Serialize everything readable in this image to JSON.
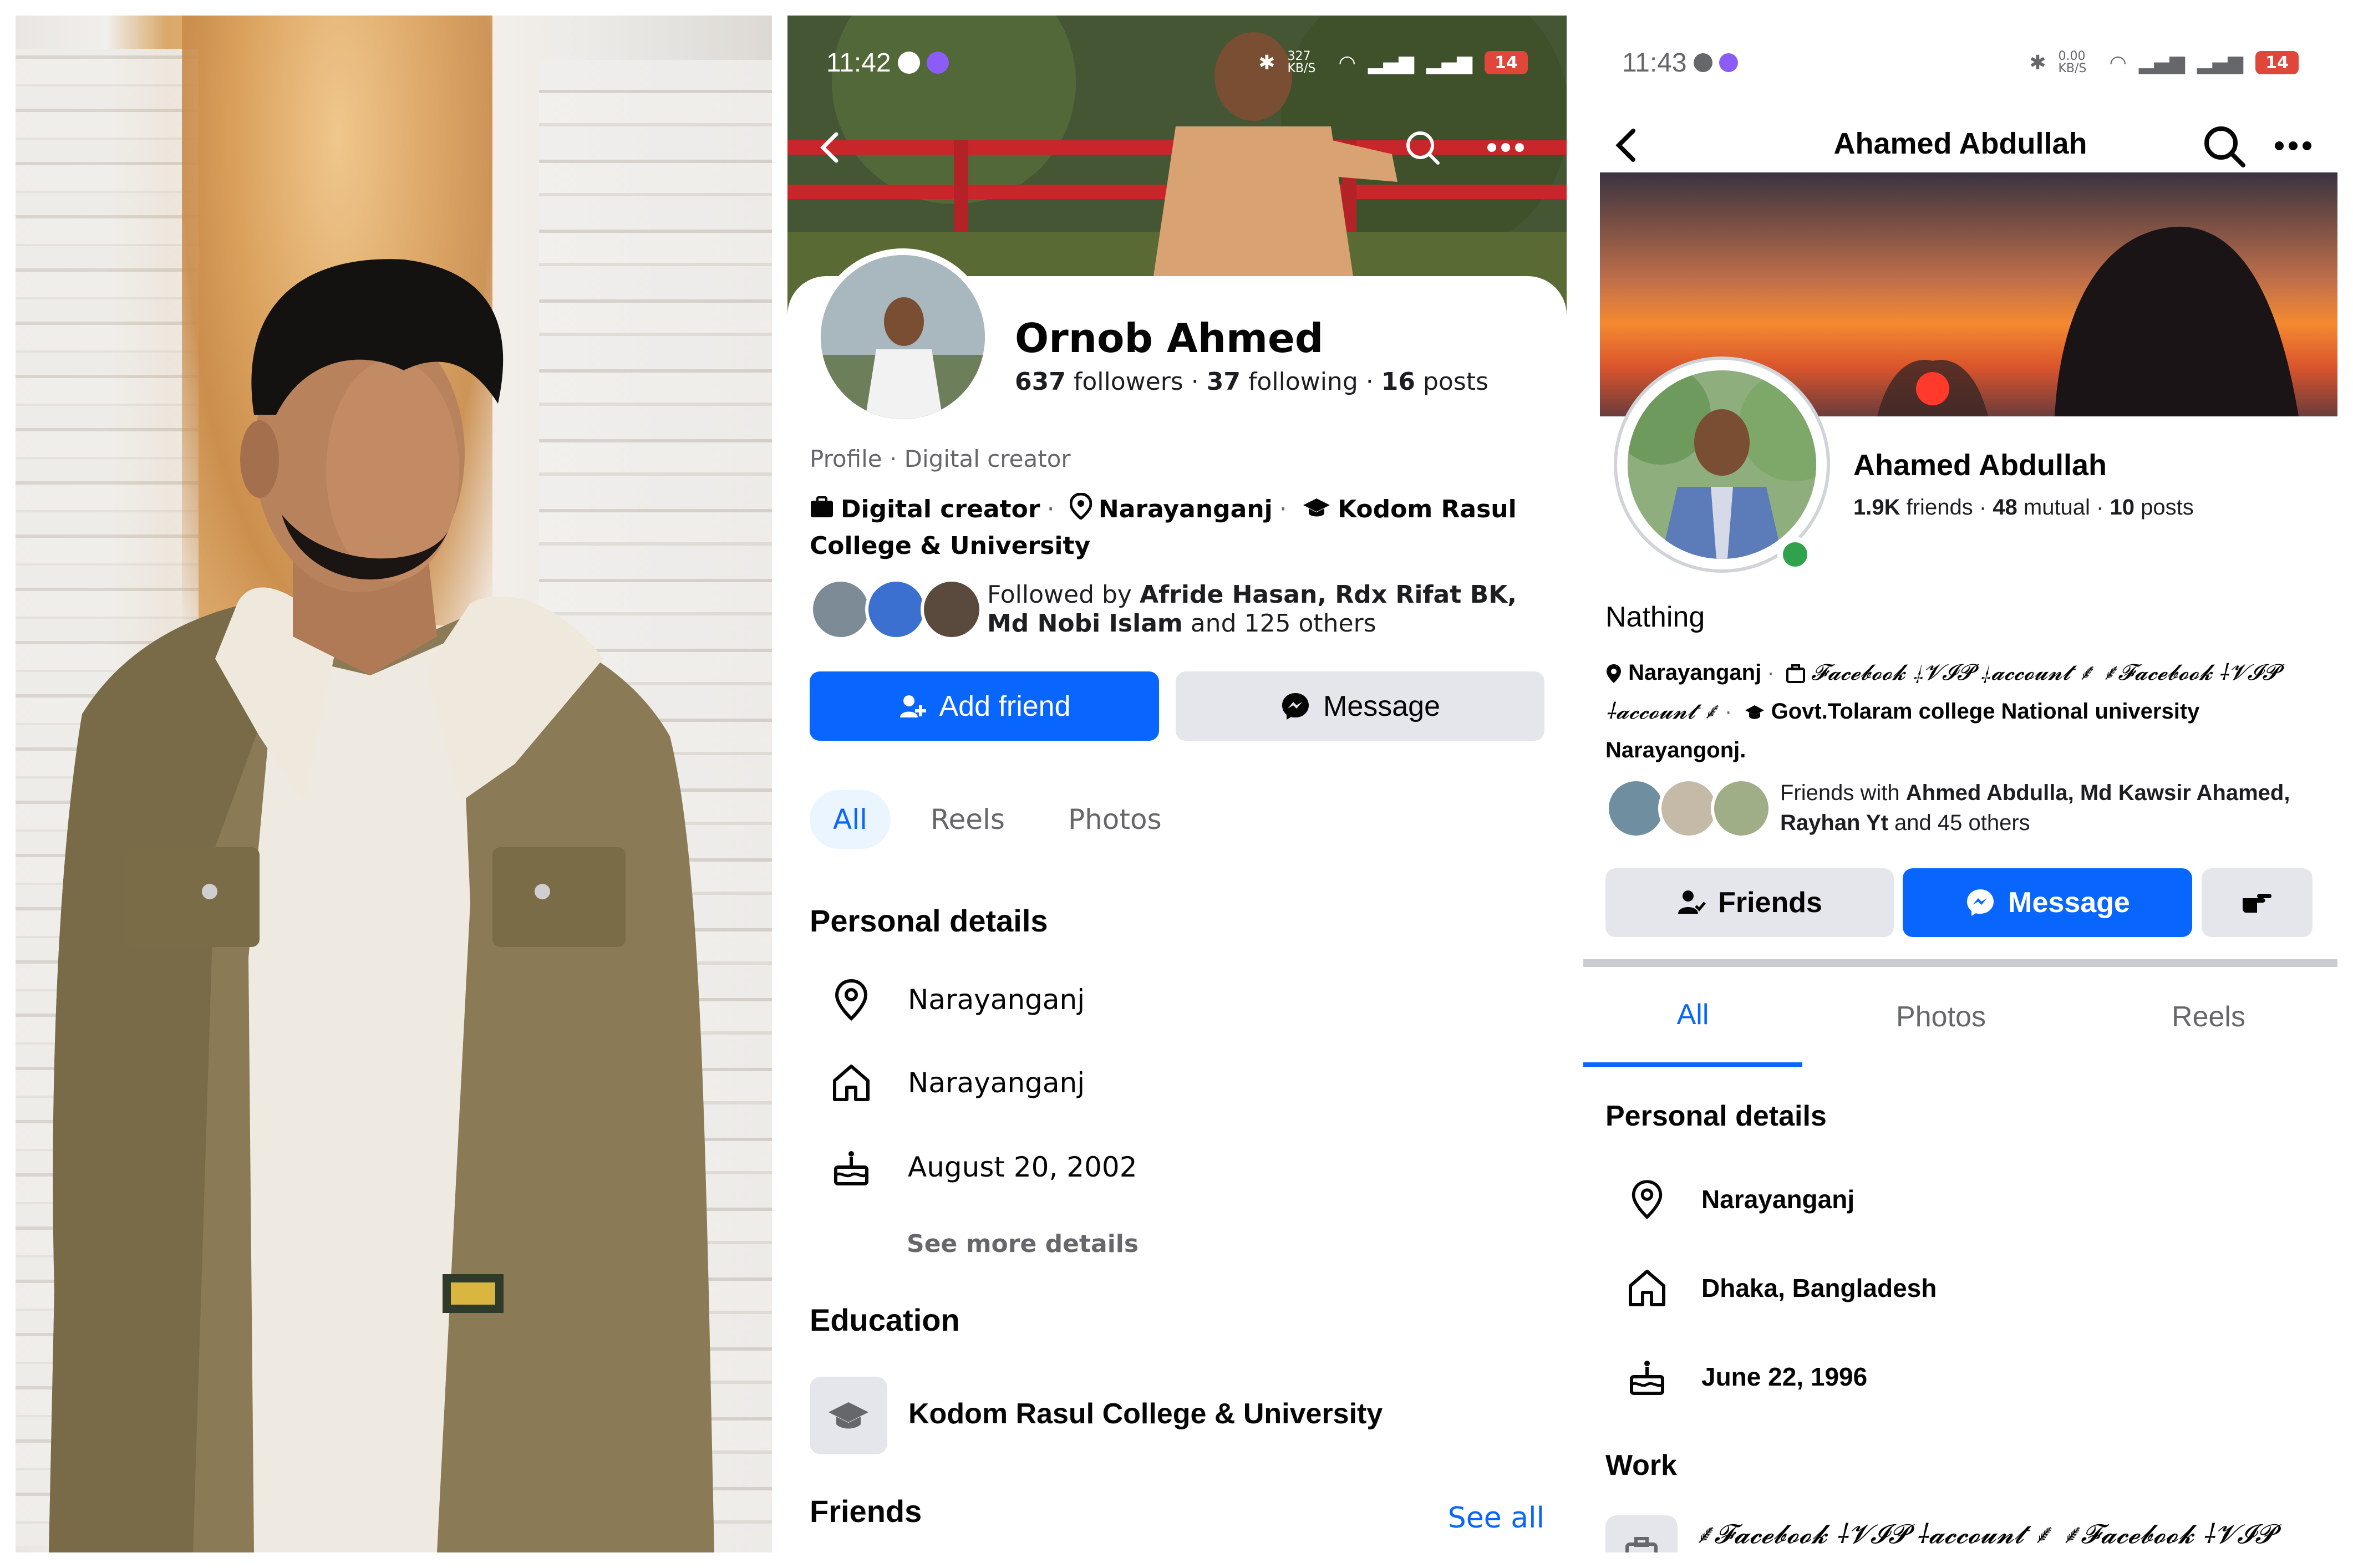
{
  "left_photo": {
    "alt": ""
  },
  "profile_a": {
    "status_time": "11:42",
    "status_speed": "327 KB/S",
    "status_battery": "14",
    "name": "Ornob Ahmed",
    "followers_count": "637",
    "followers_label": "followers",
    "following_count": "37",
    "following_label": "following",
    "posts_count": "16",
    "posts_label": "posts",
    "category": "Profile · Digital creator",
    "intro_category": "Digital creator",
    "intro_location": "Narayanganj",
    "intro_school": "Kodom Rasul College & University",
    "followed_prefix": "Followed by ",
    "followed_names": "Afride Hasan, Rdx Rifat BK, Md Nobi Islam",
    "followed_suffix": " and 125 others",
    "add_friend_label": "Add friend",
    "message_label": "Message",
    "tabs": [
      "All",
      "Reels",
      "Photos"
    ],
    "personal_details_title": "Personal details",
    "details": [
      {
        "icon": "location-pin-icon",
        "text": "Narayanganj"
      },
      {
        "icon": "home-icon",
        "text": "Narayanganj"
      },
      {
        "icon": "birthday-cake-icon",
        "text": "August 20, 2002"
      }
    ],
    "see_more_details": "See more details",
    "education_title": "Education",
    "education_school": "Kodom Rasul College & University",
    "friends_title": "Friends",
    "see_all": "See all"
  },
  "profile_b": {
    "status_time": "11:43",
    "status_speed": "0.00 KB/S",
    "status_battery": "14",
    "header_title": "Ahamed Abdullah",
    "name": "Ahamed Abdullah",
    "friends_count": "1.9K",
    "friends_label": "friends",
    "mutual_count": "48",
    "mutual_label": "mutual",
    "posts_count": "10",
    "posts_label": "posts",
    "bio": "Nathing",
    "intro_location": "Narayanganj",
    "intro_work_line1": "🌹𝓕𝓪𝓬𝓮𝓫𝓸𝓸𝓴 🥀𝓥𝓘𝓟 🥀𝓪𝓬𝓬𝓸𝓾𝓷𝓽 🌹",
    "intro_work_short": "𝓕𝓪𝓬𝓮𝓫𝓸𝓸𝓴 ⸸𝓥𝓘𝓟 ⸸𝓪𝓬𝓬𝓸𝓾𝓷𝓽 ⸙ ⸙𝓕𝓪𝓬𝓮𝓫𝓸𝓸𝓴",
    "intro_work_short2": "⸸𝓥𝓘𝓟 ⸸𝓪𝓬𝓬𝓸𝓾𝓷𝓽 ⸙",
    "intro_school": "Govt.Tolaram college National university Narayangonj.",
    "friends_prefix": "Friends with ",
    "friends_names": "Ahmed Abdulla, Md Kawsir Ahamed, Rayhan Yt",
    "friends_suffix": " and 45 others",
    "btn_friends": "Friends",
    "btn_message": "Message",
    "tabs": [
      "All",
      "Photos",
      "Reels"
    ],
    "personal_details_title": "Personal details",
    "details": [
      {
        "icon": "location-pin-icon",
        "text": "Narayanganj"
      },
      {
        "icon": "home-icon",
        "text": "Dhaka, Bangladesh"
      },
      {
        "icon": "birthday-cake-icon",
        "text": "June 22, 1996"
      }
    ],
    "work_title": "Work",
    "work_text": "⸙𝓕𝓪𝓬𝓮𝓫𝓸𝓸𝓴 ⸸𝓥𝓘𝓟 ⸸𝓪𝓬𝓬𝓸𝓾𝓷𝓽 ⸙ ⸙𝓕𝓪𝓬𝓮𝓫𝓸𝓸𝓴 ⸸𝓥𝓘𝓟"
  },
  "colors": {
    "facebook_blue": "#0866ff",
    "button_gray": "#e4e6eb",
    "online_green": "#31a24c",
    "battery_red": "#e0463a"
  }
}
